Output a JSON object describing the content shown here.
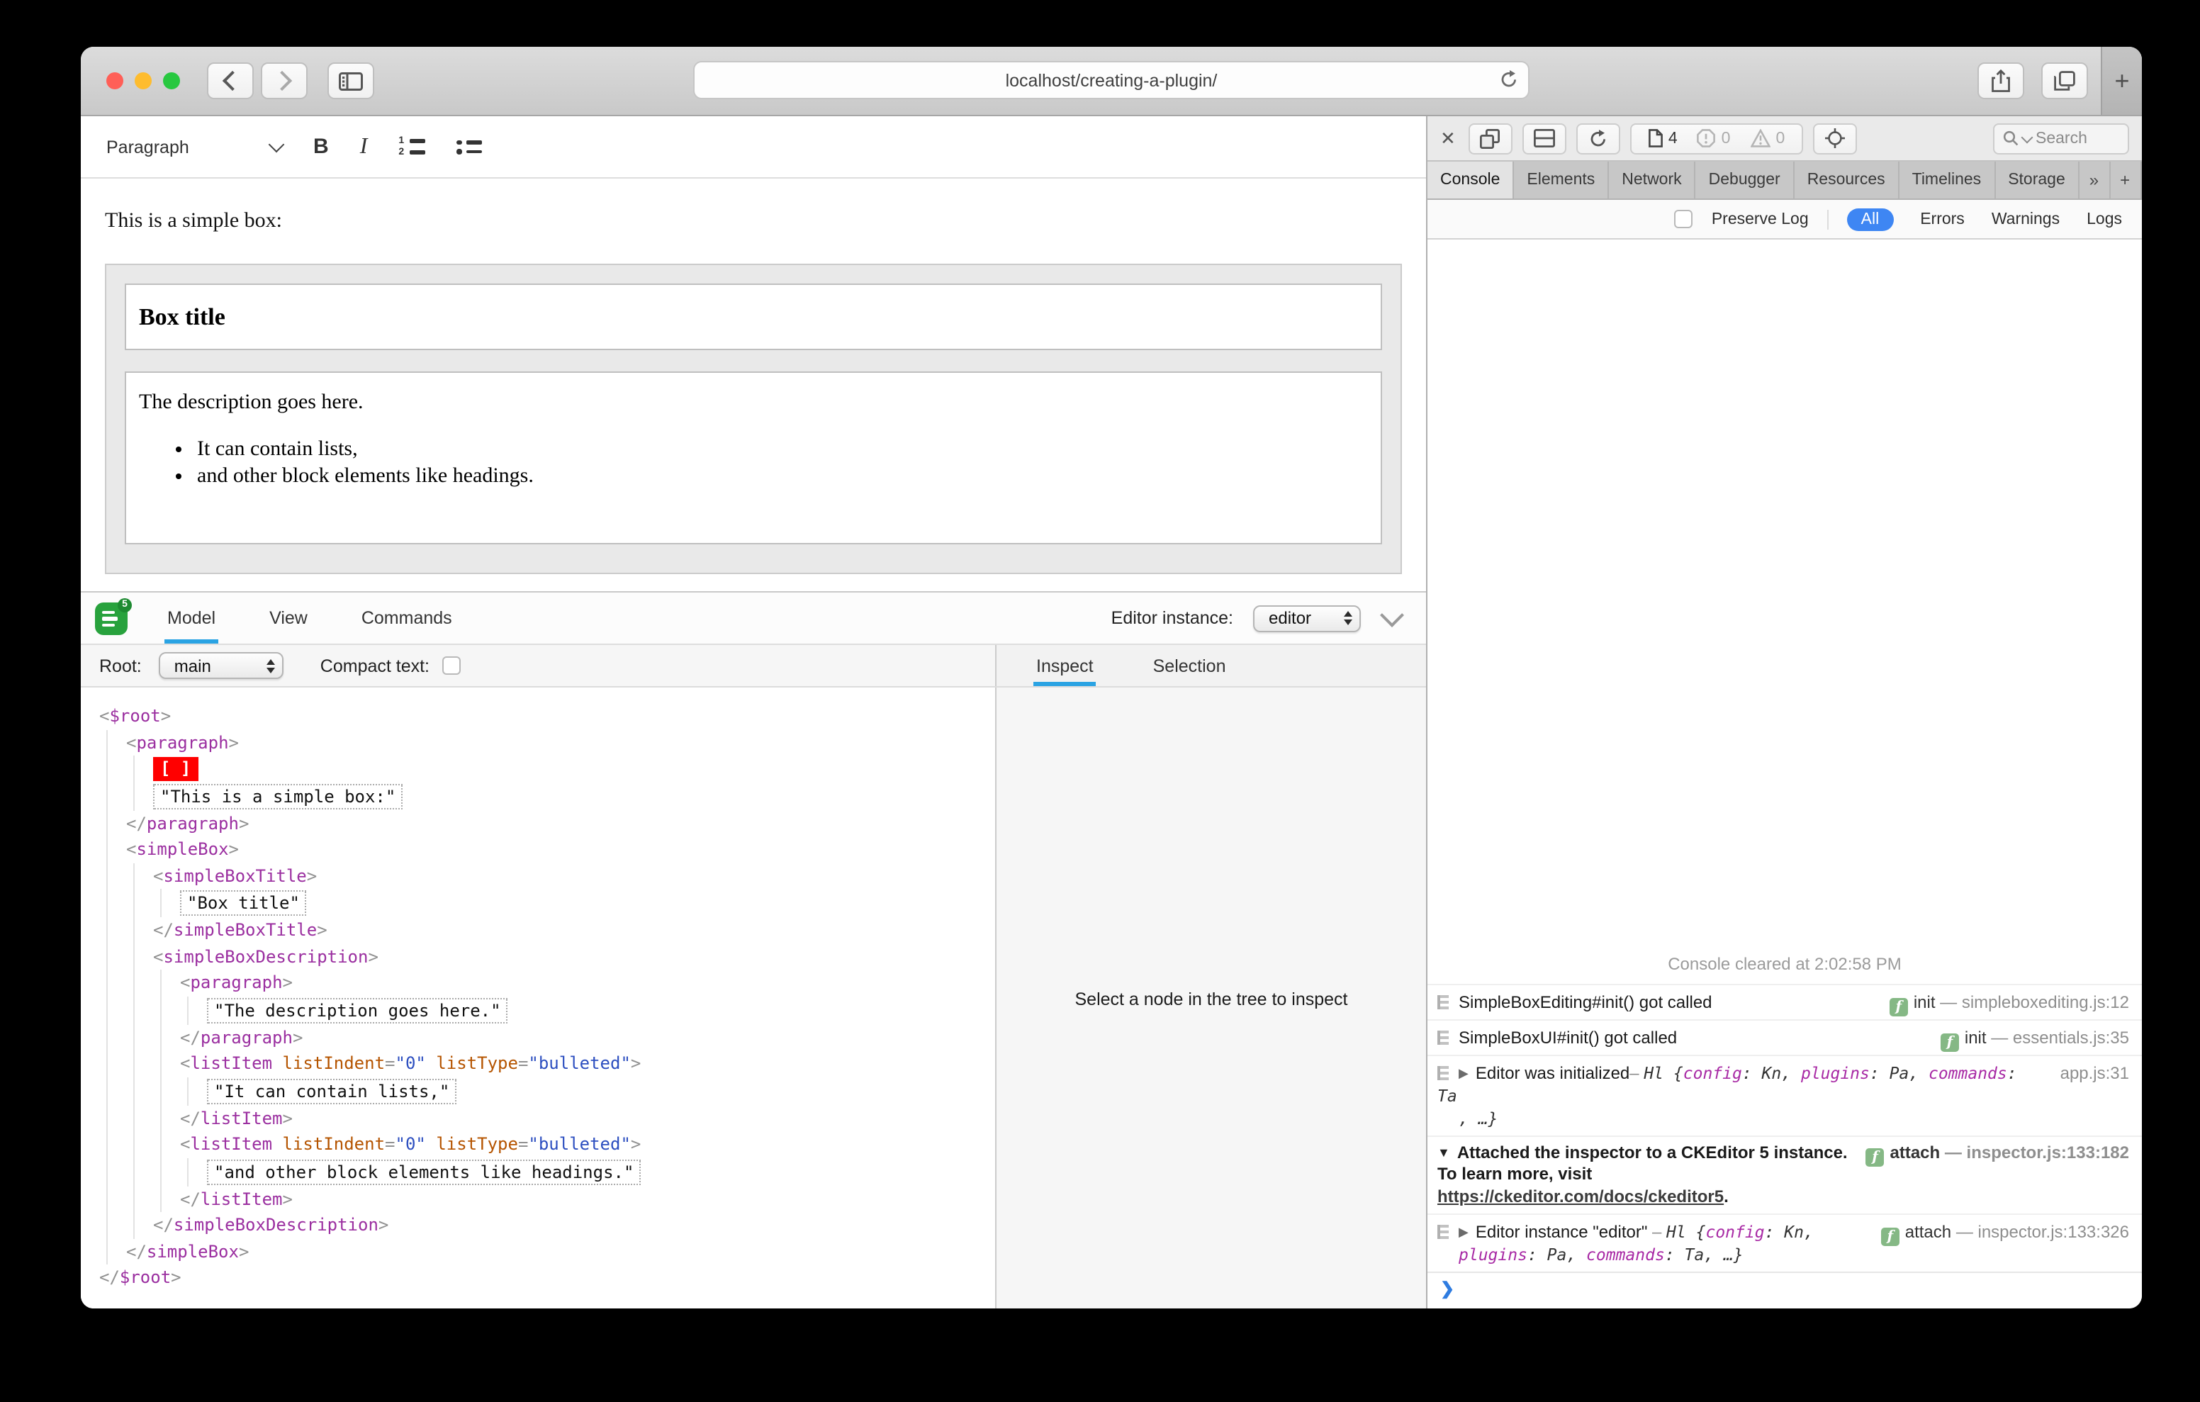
{
  "browser": {
    "url": "localhost/creating-a-plugin/",
    "new_tab_label": "+",
    "traffic_colors": [
      "#ff5f57",
      "#febc2e",
      "#28c840"
    ]
  },
  "editor": {
    "toolbar": {
      "paragraph_label": "Paragraph"
    },
    "content": {
      "intro": "This is a simple box:",
      "box_title": "Box title",
      "description": "The description goes here.",
      "bullets": [
        "It can contain lists,",
        "and other block elements like headings."
      ]
    }
  },
  "inspector": {
    "tabs": [
      "Model",
      "View",
      "Commands"
    ],
    "active_tab": "Model",
    "editor_instance_label": "Editor instance:",
    "editor_instance_value": "editor",
    "root_label": "Root:",
    "root_value": "main",
    "compact_label": "Compact text:",
    "side_tabs": [
      "Inspect",
      "Selection"
    ],
    "active_side_tab": "Inspect",
    "empty_message": "Select a node in the tree to inspect",
    "accent_color": "#2aa3e3",
    "marker_color": "#ff0000",
    "tag_color": "#9b2fa0",
    "tree": [
      {
        "i": 0,
        "open": "$root"
      },
      {
        "i": 1,
        "open": "paragraph"
      },
      {
        "i": 2,
        "marker": "[ ]"
      },
      {
        "i": 2,
        "text": "This is a simple box:"
      },
      {
        "i": 1,
        "close": "paragraph"
      },
      {
        "i": 1,
        "open": "simpleBox"
      },
      {
        "i": 2,
        "open": "simpleBoxTitle"
      },
      {
        "i": 3,
        "text": "Box title"
      },
      {
        "i": 2,
        "close": "simpleBoxTitle"
      },
      {
        "i": 2,
        "open": "simpleBoxDescription"
      },
      {
        "i": 3,
        "open": "paragraph"
      },
      {
        "i": 4,
        "text": "The description goes here."
      },
      {
        "i": 3,
        "close": "paragraph"
      },
      {
        "i": 3,
        "open": "listItem",
        "attrs": [
          [
            "listIndent",
            "0"
          ],
          [
            "listType",
            "bulleted"
          ]
        ]
      },
      {
        "i": 4,
        "text": "It can contain lists,"
      },
      {
        "i": 3,
        "close": "listItem"
      },
      {
        "i": 3,
        "open": "listItem",
        "attrs": [
          [
            "listIndent",
            "0"
          ],
          [
            "listType",
            "bulleted"
          ]
        ]
      },
      {
        "i": 4,
        "text": "and other block elements like headings."
      },
      {
        "i": 3,
        "close": "listItem"
      },
      {
        "i": 2,
        "close": "simpleBoxDescription"
      },
      {
        "i": 1,
        "close": "simpleBox"
      },
      {
        "i": 0,
        "close": "$root"
      }
    ]
  },
  "devtools": {
    "tabs": [
      "Console",
      "Elements",
      "Network",
      "Debugger",
      "Resources",
      "Timelines",
      "Storage"
    ],
    "active_tab": "Console",
    "badges": {
      "pages": "4",
      "errors": "0",
      "warnings": "0"
    },
    "search_label": "Search",
    "filter": {
      "preserve_log_label": "Preserve Log",
      "options": [
        "All",
        "Errors",
        "Warnings",
        "Logs"
      ],
      "active": "All",
      "active_color": "#3e86f3"
    },
    "badge_green": "#85b885",
    "messages": [
      {
        "kind": "cleared",
        "text": "Console cleared at 2:02:58 PM"
      },
      {
        "kind": "log",
        "text": "SimpleBoxEditing#init() got called",
        "badge": "init",
        "file": "simpleboxediting.js:12"
      },
      {
        "kind": "log",
        "text": "SimpleBoxUI#init() got called",
        "badge": "init",
        "file": "essentials.js:35"
      },
      {
        "kind": "log",
        "disclosure": "closed",
        "text": "Editor was initialized",
        "sep": "– ",
        "cls": "Hl ",
        "code": [
          [
            "p",
            "{"
          ],
          [
            "k",
            "config"
          ],
          [
            "p",
            ": Kn, "
          ],
          [
            "k",
            "plugins"
          ],
          [
            "p",
            ": Pa, "
          ],
          [
            "k",
            "commands"
          ],
          [
            "p",
            ": Ta"
          ]
        ],
        "code2": [
          [
            "p",
            ", …}"
          ]
        ],
        "file": "app.js:31"
      },
      {
        "kind": "bold",
        "disclosure": "open",
        "text": "Attached the inspector to a CKEditor 5 instance. To learn more, visit ",
        "link": "https://ckeditor.com/docs/ckeditor5",
        "tail": ".",
        "badge": "attach",
        "file": "inspector.js:133:182"
      },
      {
        "kind": "log",
        "disclosure": "closed",
        "text": "Editor instance \"editor\"",
        "sep": " – ",
        "cls": "Hl ",
        "code": [
          [
            "p",
            "{"
          ],
          [
            "k",
            "config"
          ],
          [
            "p",
            ": Kn,"
          ]
        ],
        "code2": [
          [
            "k",
            "plugins"
          ],
          [
            "p",
            ": Pa, "
          ],
          [
            "k",
            "commands"
          ],
          [
            "p",
            ": Ta, …}"
          ]
        ],
        "badge": "attach",
        "file": "inspector.js:133:326"
      }
    ],
    "prompt_char": "❯"
  }
}
